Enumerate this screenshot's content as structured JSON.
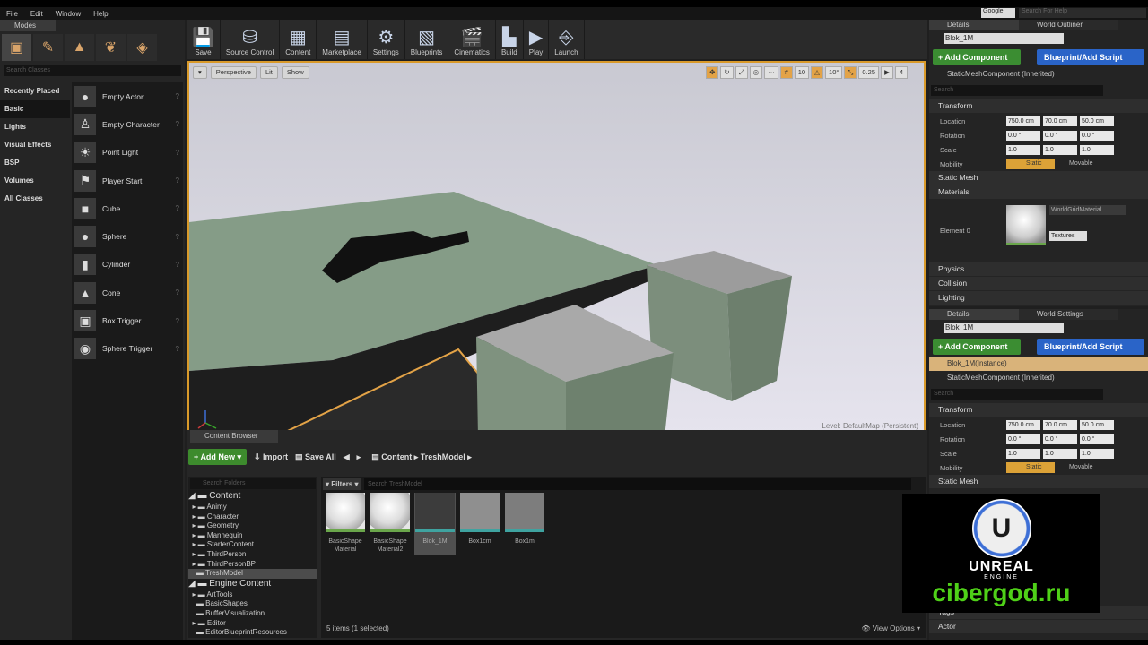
{
  "menu": [
    "File",
    "Edit",
    "Window",
    "Help"
  ],
  "search_provider": "Google",
  "help_search_placeholder": "Search For Help",
  "modes": {
    "tab": "Modes",
    "search_placeholder": "Search Classes",
    "categories": [
      "Recently Placed",
      "Basic",
      "Lights",
      "Visual Effects",
      "BSP",
      "Volumes",
      "All Classes"
    ],
    "selected_category": "Basic",
    "items": [
      {
        "label": "Empty Actor",
        "icon": "sphere-icon"
      },
      {
        "label": "Empty Character",
        "icon": "character-icon"
      },
      {
        "label": "Point Light",
        "icon": "light-bulb-icon"
      },
      {
        "label": "Player Start",
        "icon": "player-start-icon"
      },
      {
        "label": "Cube",
        "icon": "cube-icon"
      },
      {
        "label": "Sphere",
        "icon": "sphere-icon"
      },
      {
        "label": "Cylinder",
        "icon": "cylinder-icon"
      },
      {
        "label": "Cone",
        "icon": "cone-icon"
      },
      {
        "label": "Box Trigger",
        "icon": "box-trigger-icon"
      },
      {
        "label": "Sphere Trigger",
        "icon": "sphere-trigger-icon"
      }
    ]
  },
  "toolbar": [
    {
      "label": "Save",
      "icon": "save-icon"
    },
    {
      "label": "Source Control",
      "icon": "source-control-icon"
    },
    {
      "label": "Content",
      "icon": "content-icon"
    },
    {
      "label": "Marketplace",
      "icon": "marketplace-icon"
    },
    {
      "label": "Settings",
      "icon": "settings-icon"
    },
    {
      "label": "Blueprints",
      "icon": "blueprints-icon"
    },
    {
      "label": "Cinematics",
      "icon": "cinematics-icon"
    },
    {
      "label": "Build",
      "icon": "build-icon"
    },
    {
      "label": "Play",
      "icon": "play-icon"
    },
    {
      "label": "Launch",
      "icon": "launch-icon"
    }
  ],
  "viewport": {
    "perspective": "Perspective",
    "lit": "Lit",
    "show": "Show",
    "grid_snap": "10",
    "rotation_snap": "10°",
    "scale_snap": "0.25",
    "camera_speed": "4",
    "level_label": "Level: DefaultMap (Persistent)"
  },
  "content_browser": {
    "tab": "Content Browser",
    "add_new": "Add New",
    "import": "Import",
    "save_all": "Save All",
    "path": [
      "Content",
      "TreshModel"
    ],
    "search_folders": "Search Folders",
    "filters": "Filters",
    "search_assets": "Search TreshModel",
    "folders_top": "Content",
    "folders": [
      "Animy",
      "Character",
      "Geometry",
      "Mannequin",
      "StarterContent",
      "ThirdPerson",
      "ThirdPersonBP",
      "TreshModel"
    ],
    "engine_top": "Engine Content",
    "engine_folders": [
      "ArtTools",
      "BasicShapes",
      "BufferVisualization",
      "Editor",
      "EditorBlueprintResources"
    ],
    "assets": [
      {
        "name": "BasicShape Material",
        "kind": "material"
      },
      {
        "name": "BasicShape Material2",
        "kind": "material"
      },
      {
        "name": "Blok_1M",
        "kind": "mesh",
        "selected": true
      },
      {
        "name": "Box1cm",
        "kind": "mesh"
      },
      {
        "name": "Box1m",
        "kind": "mesh"
      }
    ],
    "count": "5 items (1 selected)",
    "view_options": "View Options"
  },
  "details_top": {
    "tab_details": "Details",
    "tab_other": "World Outliner",
    "name": "Blok_1M",
    "add_component": "+ Add Component",
    "blueprint": "Blueprint/Add Script",
    "component": "StaticMeshComponent (Inherited)",
    "search": "Search",
    "transform": "Transform",
    "location_label": "Location",
    "location": [
      "750.0 cm",
      "70.0 cm",
      "50.0 cm"
    ],
    "rotation_label": "Rotation",
    "rotation": [
      "0.0 °",
      "0.0 °",
      "0.0 °"
    ],
    "scale_label": "Scale",
    "scale": [
      "1.0",
      "1.0",
      "1.0"
    ],
    "mobility_label": "Mobility",
    "static": "Static",
    "movable": "Movable",
    "static_mesh": "Static Mesh",
    "materials": "Materials",
    "element0": "Element 0",
    "material_name": "WorldGridMaterial",
    "textures": "Textures",
    "physics": "Physics",
    "collision": "Collision",
    "lighting": "Lighting"
  },
  "details_bottom": {
    "tab_details": "Details",
    "tab_other": "World Settings",
    "name": "Blok_1M",
    "add_component": "+ Add Component",
    "blueprint": "Blueprint/Add Script",
    "instance": "Blok_1M(Instance)",
    "component": "StaticMeshComponent (Inherited)",
    "search": "Search",
    "transform": "Transform",
    "location_label": "Location",
    "location": [
      "750.0 cm",
      "70.0 cm",
      "50.0 cm"
    ],
    "rotation_label": "Rotation",
    "rotation": [
      "0.0 °",
      "0.0 °",
      "0.0 °"
    ],
    "scale_label": "Scale",
    "scale": [
      "1.0",
      "1.0",
      "1.0"
    ],
    "mobility_label": "Mobility",
    "static": "Static",
    "movable": "Movable",
    "static_mesh": "Static Mesh",
    "tags": "Tags",
    "actor": "Actor"
  },
  "watermark": {
    "brand": "UNREAL",
    "sub": "ENGINE",
    "site": "cibergod.ru"
  }
}
